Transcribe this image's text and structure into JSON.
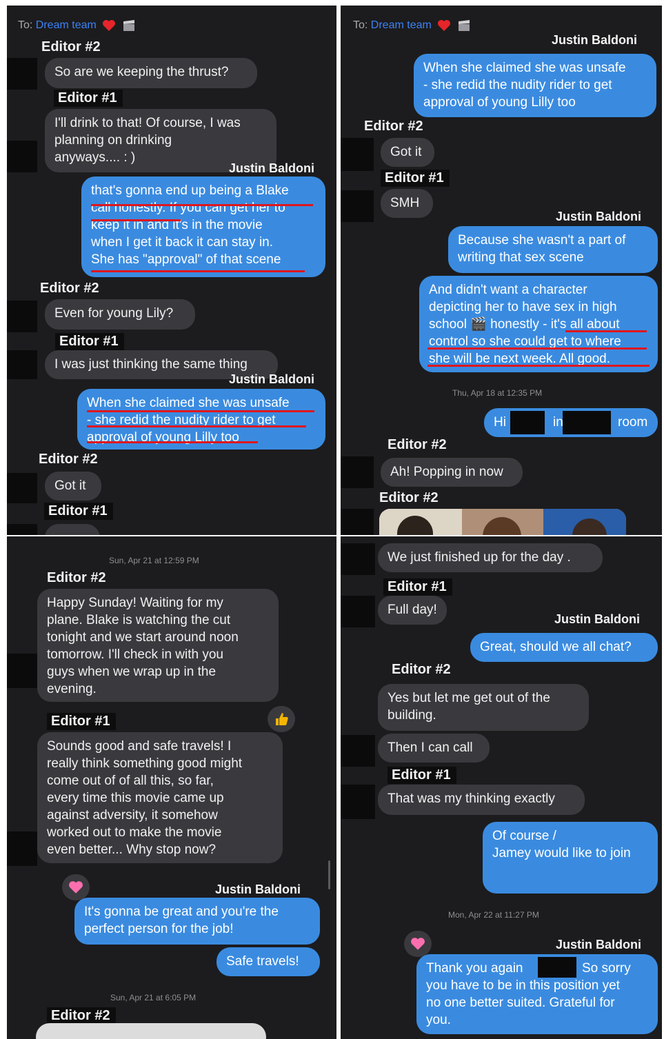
{
  "colors": {
    "panel": "#1c1c1e",
    "incoming": "#3a3a3e",
    "outgoing": "#3a8be0",
    "underline": "#e0161c",
    "link": "#3b82f6"
  },
  "header": {
    "to_prefix": "To:",
    "recipient": "Dream team",
    "icons": [
      "heart-icon",
      "clapperboard-icon"
    ]
  },
  "names": {
    "editor1": "Editor #1",
    "editor2": "Editor #2",
    "justin": "Justin Baldoni"
  },
  "tl": {
    "m1": "So are we keeping the thrust?",
    "m2": "I'll drink to that! Of course, I was\nplanning on drinking\nanyways.... : )",
    "m3": "that's gonna end up being a Blake\ncall honestly. If you can get her to\nkeep it in and it's in the movie\nwhen I get it back it can stay in.\nShe has \"approval\" of that scene",
    "m4": "Even for young Lily?",
    "m5": "I was just thinking the same thing",
    "m6": "When she claimed she was unsafe\n- she redid the nudity rider to get\napproval of young Lilly too",
    "m7": "Got it"
  },
  "tr": {
    "m1": "When she claimed she was unsafe\n- she redid the nudity rider to get\napproval of young Lilly too",
    "m2": "Got it",
    "m3": "SMH",
    "m4": "Because she wasn't a part of\nwriting that sex scene",
    "m5": "And didn't want a character\ndepicting her to have sex in high\nschool 🎬 honestly - it's all about\ncontrol so she could get to where\nshe will be next week. All good.",
    "ts": "Thu, Apr 18 at 12:35 PM",
    "m6_a": "Hi",
    "m6_b": "in",
    "m6_c": "room",
    "m7": "Ah! Popping in now"
  },
  "bl": {
    "ts1": "Sun, Apr 21 at 12:59 PM",
    "m1": "Happy Sunday! Waiting for my\nplane. Blake is watching the cut\ntonight and we start around noon\ntomorrow. I'll check in with you\nguys when we wrap up in the\nevening.",
    "m2": "Sounds good and safe travels! I\nreally think something good might\ncome out of of all this, so far,\nevery time this movie came up\nagainst adversity, it somehow\nworked out to make the movie\neven better... Why stop now?",
    "m3": "It's gonna be great and you're the\nperfect person for the job!",
    "m4": "Safe travels!",
    "ts2": "Sun, Apr 21 at 6:05 PM"
  },
  "br": {
    "m1": "We just finished up for the day .",
    "m2": "Full day!",
    "m3": "Great, should we all chat?",
    "m4": "Yes but let me get out of the\nbuilding.",
    "m5": "Then I can call",
    "m6": "That was my thinking exactly",
    "m7": "Of course /\nJamey would like to join",
    "ts": "Mon, Apr 22 at 11:27 PM",
    "m8_a": "Thank you again",
    "m8_b": "So sorry",
    "m8_rest": "you have to be in this position yet\nno one better suited. Grateful for\nyou."
  },
  "reactions": [
    "heart-reaction-icon",
    "thumbs-up-reaction-icon"
  ]
}
